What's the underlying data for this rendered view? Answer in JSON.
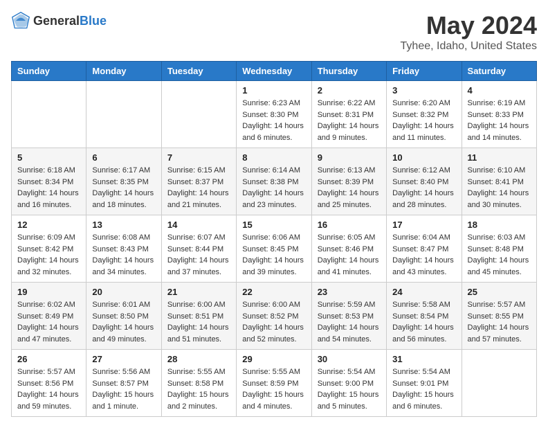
{
  "logo": {
    "general": "General",
    "blue": "Blue"
  },
  "title": "May 2024",
  "location": "Tyhee, Idaho, United States",
  "days_of_week": [
    "Sunday",
    "Monday",
    "Tuesday",
    "Wednesday",
    "Thursday",
    "Friday",
    "Saturday"
  ],
  "weeks": [
    [
      {
        "day": "",
        "info": ""
      },
      {
        "day": "",
        "info": ""
      },
      {
        "day": "",
        "info": ""
      },
      {
        "day": "1",
        "info": "Sunrise: 6:23 AM\nSunset: 8:30 PM\nDaylight: 14 hours\nand 6 minutes."
      },
      {
        "day": "2",
        "info": "Sunrise: 6:22 AM\nSunset: 8:31 PM\nDaylight: 14 hours\nand 9 minutes."
      },
      {
        "day": "3",
        "info": "Sunrise: 6:20 AM\nSunset: 8:32 PM\nDaylight: 14 hours\nand 11 minutes."
      },
      {
        "day": "4",
        "info": "Sunrise: 6:19 AM\nSunset: 8:33 PM\nDaylight: 14 hours\nand 14 minutes."
      }
    ],
    [
      {
        "day": "5",
        "info": "Sunrise: 6:18 AM\nSunset: 8:34 PM\nDaylight: 14 hours\nand 16 minutes."
      },
      {
        "day": "6",
        "info": "Sunrise: 6:17 AM\nSunset: 8:35 PM\nDaylight: 14 hours\nand 18 minutes."
      },
      {
        "day": "7",
        "info": "Sunrise: 6:15 AM\nSunset: 8:37 PM\nDaylight: 14 hours\nand 21 minutes."
      },
      {
        "day": "8",
        "info": "Sunrise: 6:14 AM\nSunset: 8:38 PM\nDaylight: 14 hours\nand 23 minutes."
      },
      {
        "day": "9",
        "info": "Sunrise: 6:13 AM\nSunset: 8:39 PM\nDaylight: 14 hours\nand 25 minutes."
      },
      {
        "day": "10",
        "info": "Sunrise: 6:12 AM\nSunset: 8:40 PM\nDaylight: 14 hours\nand 28 minutes."
      },
      {
        "day": "11",
        "info": "Sunrise: 6:10 AM\nSunset: 8:41 PM\nDaylight: 14 hours\nand 30 minutes."
      }
    ],
    [
      {
        "day": "12",
        "info": "Sunrise: 6:09 AM\nSunset: 8:42 PM\nDaylight: 14 hours\nand 32 minutes."
      },
      {
        "day": "13",
        "info": "Sunrise: 6:08 AM\nSunset: 8:43 PM\nDaylight: 14 hours\nand 34 minutes."
      },
      {
        "day": "14",
        "info": "Sunrise: 6:07 AM\nSunset: 8:44 PM\nDaylight: 14 hours\nand 37 minutes."
      },
      {
        "day": "15",
        "info": "Sunrise: 6:06 AM\nSunset: 8:45 PM\nDaylight: 14 hours\nand 39 minutes."
      },
      {
        "day": "16",
        "info": "Sunrise: 6:05 AM\nSunset: 8:46 PM\nDaylight: 14 hours\nand 41 minutes."
      },
      {
        "day": "17",
        "info": "Sunrise: 6:04 AM\nSunset: 8:47 PM\nDaylight: 14 hours\nand 43 minutes."
      },
      {
        "day": "18",
        "info": "Sunrise: 6:03 AM\nSunset: 8:48 PM\nDaylight: 14 hours\nand 45 minutes."
      }
    ],
    [
      {
        "day": "19",
        "info": "Sunrise: 6:02 AM\nSunset: 8:49 PM\nDaylight: 14 hours\nand 47 minutes."
      },
      {
        "day": "20",
        "info": "Sunrise: 6:01 AM\nSunset: 8:50 PM\nDaylight: 14 hours\nand 49 minutes."
      },
      {
        "day": "21",
        "info": "Sunrise: 6:00 AM\nSunset: 8:51 PM\nDaylight: 14 hours\nand 51 minutes."
      },
      {
        "day": "22",
        "info": "Sunrise: 6:00 AM\nSunset: 8:52 PM\nDaylight: 14 hours\nand 52 minutes."
      },
      {
        "day": "23",
        "info": "Sunrise: 5:59 AM\nSunset: 8:53 PM\nDaylight: 14 hours\nand 54 minutes."
      },
      {
        "day": "24",
        "info": "Sunrise: 5:58 AM\nSunset: 8:54 PM\nDaylight: 14 hours\nand 56 minutes."
      },
      {
        "day": "25",
        "info": "Sunrise: 5:57 AM\nSunset: 8:55 PM\nDaylight: 14 hours\nand 57 minutes."
      }
    ],
    [
      {
        "day": "26",
        "info": "Sunrise: 5:57 AM\nSunset: 8:56 PM\nDaylight: 14 hours\nand 59 minutes."
      },
      {
        "day": "27",
        "info": "Sunrise: 5:56 AM\nSunset: 8:57 PM\nDaylight: 15 hours\nand 1 minute."
      },
      {
        "day": "28",
        "info": "Sunrise: 5:55 AM\nSunset: 8:58 PM\nDaylight: 15 hours\nand 2 minutes."
      },
      {
        "day": "29",
        "info": "Sunrise: 5:55 AM\nSunset: 8:59 PM\nDaylight: 15 hours\nand 4 minutes."
      },
      {
        "day": "30",
        "info": "Sunrise: 5:54 AM\nSunset: 9:00 PM\nDaylight: 15 hours\nand 5 minutes."
      },
      {
        "day": "31",
        "info": "Sunrise: 5:54 AM\nSunset: 9:01 PM\nDaylight: 15 hours\nand 6 minutes."
      },
      {
        "day": "",
        "info": ""
      }
    ]
  ]
}
